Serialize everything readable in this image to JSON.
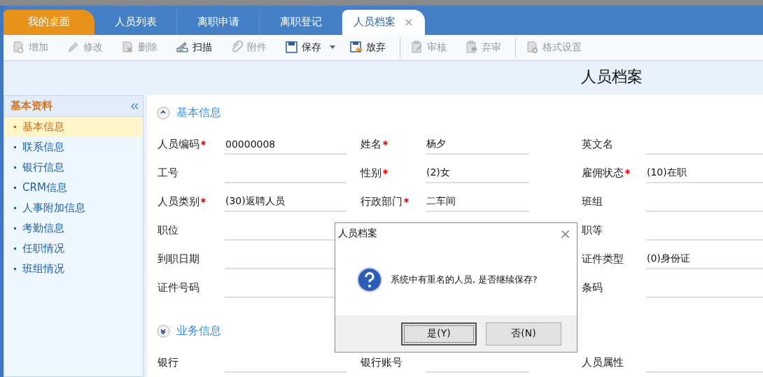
{
  "tabs": [
    {
      "label": "我的桌面",
      "kind": "home",
      "selected": false,
      "closable": false
    },
    {
      "label": "人员列表",
      "kind": "normal",
      "selected": false,
      "closable": false
    },
    {
      "label": "离职申请",
      "kind": "normal",
      "selected": false,
      "closable": false
    },
    {
      "label": "离职登记",
      "kind": "normal",
      "selected": false,
      "closable": false
    },
    {
      "label": "人员档案",
      "kind": "normal",
      "selected": true,
      "closable": true,
      "close_label": "×"
    }
  ],
  "toolbar": [
    [
      {
        "label": "增加",
        "kind": "add",
        "disabled": true,
        "dropdown": false
      },
      {
        "label": "修改",
        "kind": "edit",
        "disabled": true,
        "dropdown": false
      },
      {
        "label": "删除",
        "kind": "delete",
        "disabled": true,
        "dropdown": false
      },
      {
        "label": "扫描",
        "kind": "scan",
        "disabled": false,
        "dropdown": false
      },
      {
        "label": "附件",
        "kind": "attach",
        "disabled": true,
        "dropdown": false
      },
      {
        "label": "保存",
        "kind": "save",
        "disabled": false,
        "dropdown": true
      },
      {
        "label": "放弃",
        "kind": "discard",
        "disabled": false,
        "dropdown": false
      }
    ],
    [
      {
        "label": "审核",
        "kind": "audit",
        "disabled": true,
        "dropdown": false
      },
      {
        "label": "弃审",
        "kind": "unaudit",
        "disabled": true,
        "dropdown": false
      }
    ],
    [
      {
        "label": "格式设置",
        "kind": "format",
        "disabled": true,
        "dropdown": false
      }
    ]
  ],
  "page_title": "人员档案",
  "sidebar": {
    "title": "基本资料",
    "items": [
      {
        "label": "基本信息",
        "selected": true
      },
      {
        "label": "联系信息",
        "selected": false
      },
      {
        "label": "银行信息",
        "selected": false
      },
      {
        "label": "CRM信息",
        "selected": false
      },
      {
        "label": "人事附加信息",
        "selected": false
      },
      {
        "label": "考勤信息",
        "selected": false
      },
      {
        "label": "任职情况",
        "selected": false
      },
      {
        "label": "班组情况",
        "selected": false
      }
    ]
  },
  "sections": [
    {
      "title": "基本信息",
      "expanded": true,
      "rows": [
        [
          {
            "label": "人员编码",
            "required": true,
            "value": "00000008"
          },
          {
            "label": "姓名",
            "required": true,
            "value": "杨夕"
          },
          {
            "label": "英文名",
            "required": false
          }
        ],
        [
          {
            "label": "工号",
            "required": false
          },
          {
            "label": "性别",
            "required": true,
            "value": "(2)女"
          },
          {
            "label": "雇佣状态",
            "required": true,
            "value": "(10)在职"
          }
        ],
        [
          {
            "label": "人员类别",
            "required": true,
            "value": "(30)返聘人员"
          },
          {
            "label": "行政部门",
            "required": true,
            "value": "二车间"
          },
          {
            "label": "班组",
            "required": false
          }
        ],
        [
          {
            "label": "职位",
            "required": false
          },
          null,
          {
            "label": "职等",
            "required": false
          }
        ],
        [
          {
            "label": "到职日期",
            "required": false
          },
          null,
          {
            "label": "证件类型",
            "required": false,
            "value": "(0)身份证"
          }
        ],
        [
          {
            "label": "证件号码",
            "required": false
          },
          null,
          {
            "label": "条码",
            "required": false
          }
        ]
      ]
    },
    {
      "title": "业务信息",
      "expanded": false,
      "rows": [
        [
          {
            "label": "银行",
            "required": false
          },
          {
            "label": "银行账号",
            "required": false
          },
          {
            "label": "人员属性",
            "required": false
          }
        ]
      ]
    }
  ],
  "dialog": {
    "title": "人员档案",
    "message": "系统中有重名的人员, 是否继续保存?",
    "close_label": "×",
    "buttons": [
      {
        "label": "是(Y)",
        "focused": true
      },
      {
        "label": "否(N)",
        "focused": false
      }
    ]
  }
}
